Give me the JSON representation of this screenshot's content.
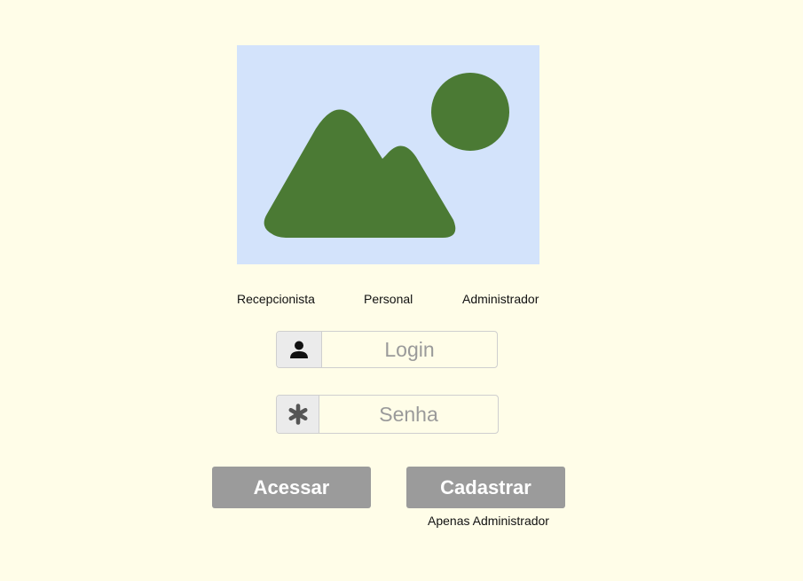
{
  "logo": {
    "icon": "image-placeholder-icon",
    "colors": {
      "background": "#d3e3fb",
      "foreground": "#4b7a34"
    }
  },
  "roles": [
    {
      "label": "Recepcionista"
    },
    {
      "label": "Personal"
    },
    {
      "label": "Administrador"
    }
  ],
  "login": {
    "icon": "user-icon",
    "placeholder": "Login",
    "value": ""
  },
  "password": {
    "icon": "asterisk-icon",
    "placeholder": "Senha",
    "value": ""
  },
  "buttons": {
    "acessar_label": "Acessar",
    "cadastrar_label": "Cadastrar",
    "cadastrar_note": "Apenas Administrador"
  },
  "colors": {
    "page_background": "#fffde8",
    "button_background": "#9b9b9b",
    "button_text": "#ffffff"
  }
}
